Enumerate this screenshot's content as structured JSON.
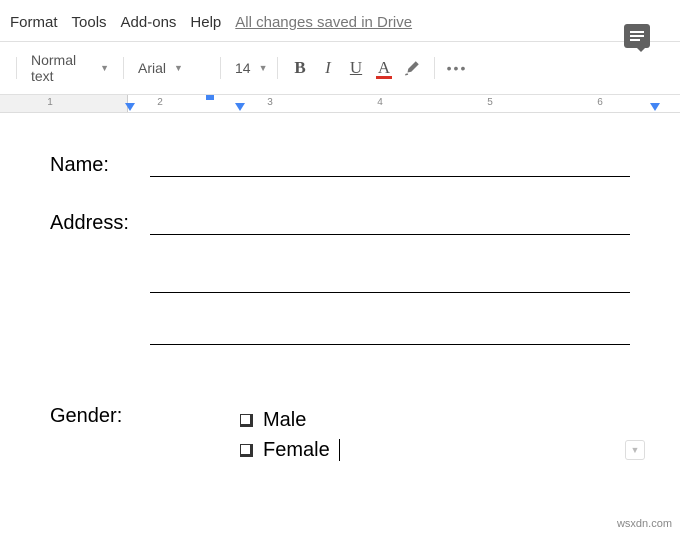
{
  "menubar": {
    "format": "Format",
    "tools": "Tools",
    "addons": "Add-ons",
    "help": "Help",
    "saved_status": "All changes saved in Drive"
  },
  "toolbar": {
    "style_label": "Normal text",
    "font_label": "Arial",
    "font_size": "14",
    "more": "•••"
  },
  "ruler": {
    "labels": [
      "1",
      "2",
      "3",
      "4",
      "5",
      "6"
    ]
  },
  "document": {
    "name_label": "Name:",
    "address_label": "Address:",
    "gender_label": "Gender:",
    "gender_options": [
      "Male",
      "Female"
    ]
  },
  "watermark": "wsxdn.com"
}
